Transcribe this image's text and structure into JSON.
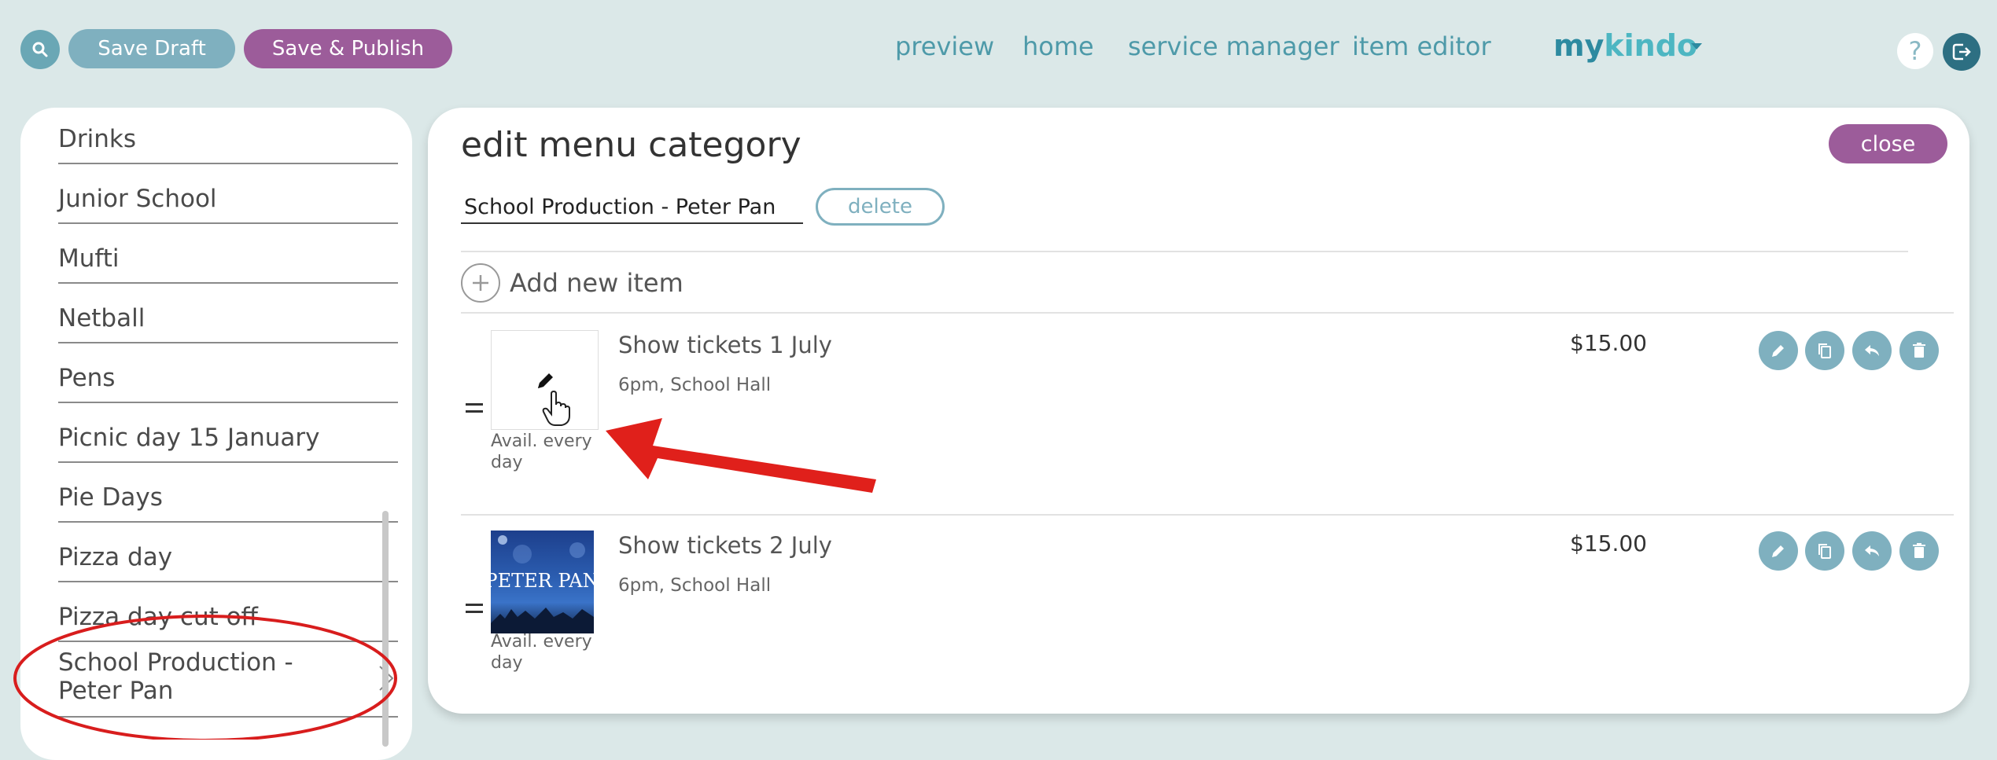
{
  "toolbar": {
    "save_draft_label": "Save Draft",
    "save_publish_label": "Save & Publish"
  },
  "nav": {
    "links": [
      "preview",
      "home",
      "service manager",
      "item editor"
    ],
    "brand_part1": "my",
    "brand_part2": "kindo",
    "help_label": "?"
  },
  "sidebar": {
    "items": [
      {
        "label": "Drinks"
      },
      {
        "label": "Junior School"
      },
      {
        "label": "Mufti"
      },
      {
        "label": "Netball"
      },
      {
        "label": "Pens"
      },
      {
        "label": "Picnic day 15 January"
      },
      {
        "label": "Pie Days"
      },
      {
        "label": "Pizza day"
      },
      {
        "label": "Pizza day cut off"
      },
      {
        "label_line1": "School Production -",
        "label_line2": "Peter Pan",
        "selected": true
      }
    ]
  },
  "panel": {
    "title": "edit menu category",
    "close_label": "close",
    "category_value": "School Production - Peter Pan",
    "delete_label": "delete",
    "add_item_label": "Add new item"
  },
  "items": [
    {
      "name": "Show tickets 1 July",
      "description": "6pm, School Hall",
      "price": "$15.00",
      "availability_line1": "Avail. every",
      "availability_line2": "day",
      "has_image": false
    },
    {
      "name": "Show tickets 2 July",
      "description": "6pm, School Hall",
      "price": "$15.00",
      "availability_line1": "Avail. every",
      "availability_line2": "day",
      "has_image": true,
      "image_text": "PETER PAN"
    }
  ],
  "colors": {
    "background": "#dbe8e8",
    "accent_purple": "#9c5c9a",
    "accent_teal": "#7fb0bf",
    "annotation_red": "#e0201b"
  },
  "icons": [
    "search-icon",
    "help-icon",
    "logout-icon",
    "plus-icon",
    "pencil-icon",
    "copy-icon",
    "reply-icon",
    "trash-icon",
    "chevron-right-icon",
    "drag-handle-icon",
    "hand-cursor-icon"
  ]
}
